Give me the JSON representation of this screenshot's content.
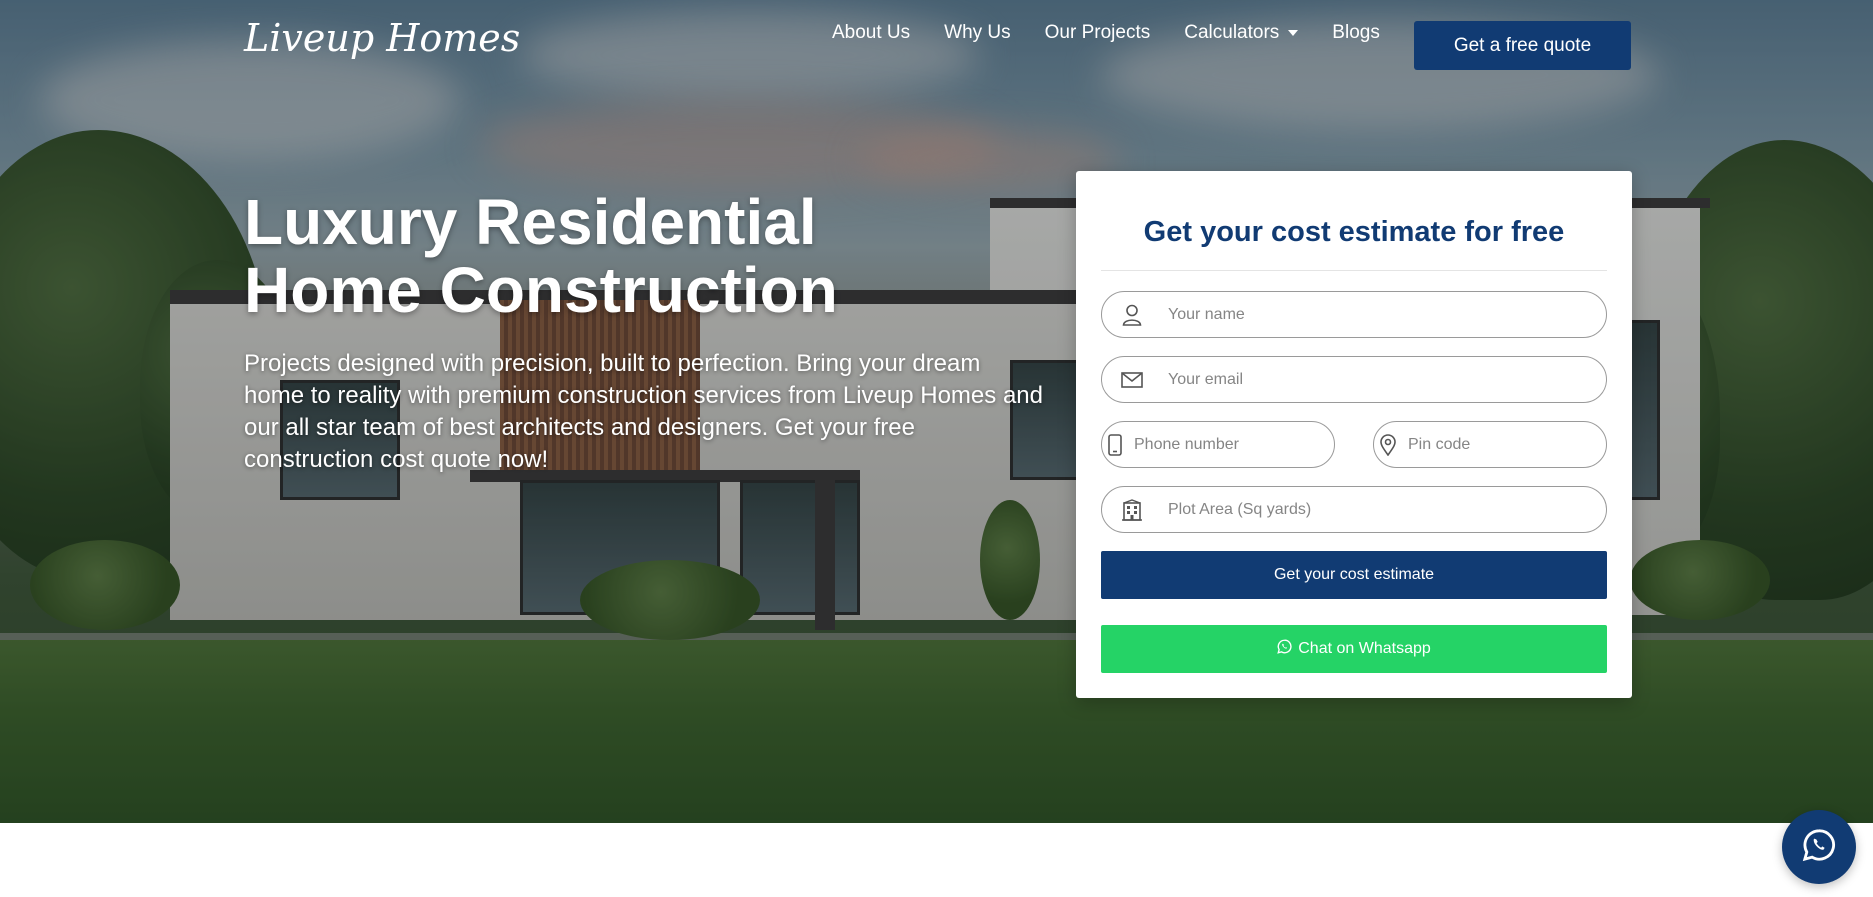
{
  "brand": {
    "logo_text": "Liveup Homes"
  },
  "nav": {
    "items": [
      {
        "label": "About Us"
      },
      {
        "label": "Why Us"
      },
      {
        "label": "Our Projects"
      },
      {
        "label": "Calculators"
      },
      {
        "label": "Blogs"
      }
    ],
    "cta_label": "Get a free quote"
  },
  "hero": {
    "title_line1": "Luxury Residential",
    "title_line2": "Home Construction",
    "subtitle": "Projects designed with precision, built to perfection. Bring your dream home to reality with premium construction services from Liveup Homes and our all star team of best architects and designers. Get your free construction cost quote now!"
  },
  "form": {
    "title": "Get your cost estimate for free",
    "fields": {
      "name": {
        "placeholder": "Your name",
        "value": "",
        "icon": "user-icon"
      },
      "email": {
        "placeholder": "Your email",
        "value": "",
        "icon": "envelope-icon"
      },
      "phone": {
        "placeholder": "Phone number",
        "value": "",
        "icon": "mobile-icon"
      },
      "pin": {
        "placeholder": "Pin code",
        "value": "",
        "icon": "map-pin-icon"
      },
      "area": {
        "placeholder": "Plot Area (Sq yards)",
        "value": "",
        "icon": "building-icon"
      }
    },
    "submit_label": "Get your cost estimate",
    "whatsapp_label": "Chat on Whatsapp"
  },
  "colors": {
    "primary": "#113b73",
    "whatsapp_green": "#25d366",
    "card_bg": "#ffffff",
    "text_on_dark": "#ffffff"
  },
  "floating": {
    "icon": "whatsapp-icon"
  }
}
